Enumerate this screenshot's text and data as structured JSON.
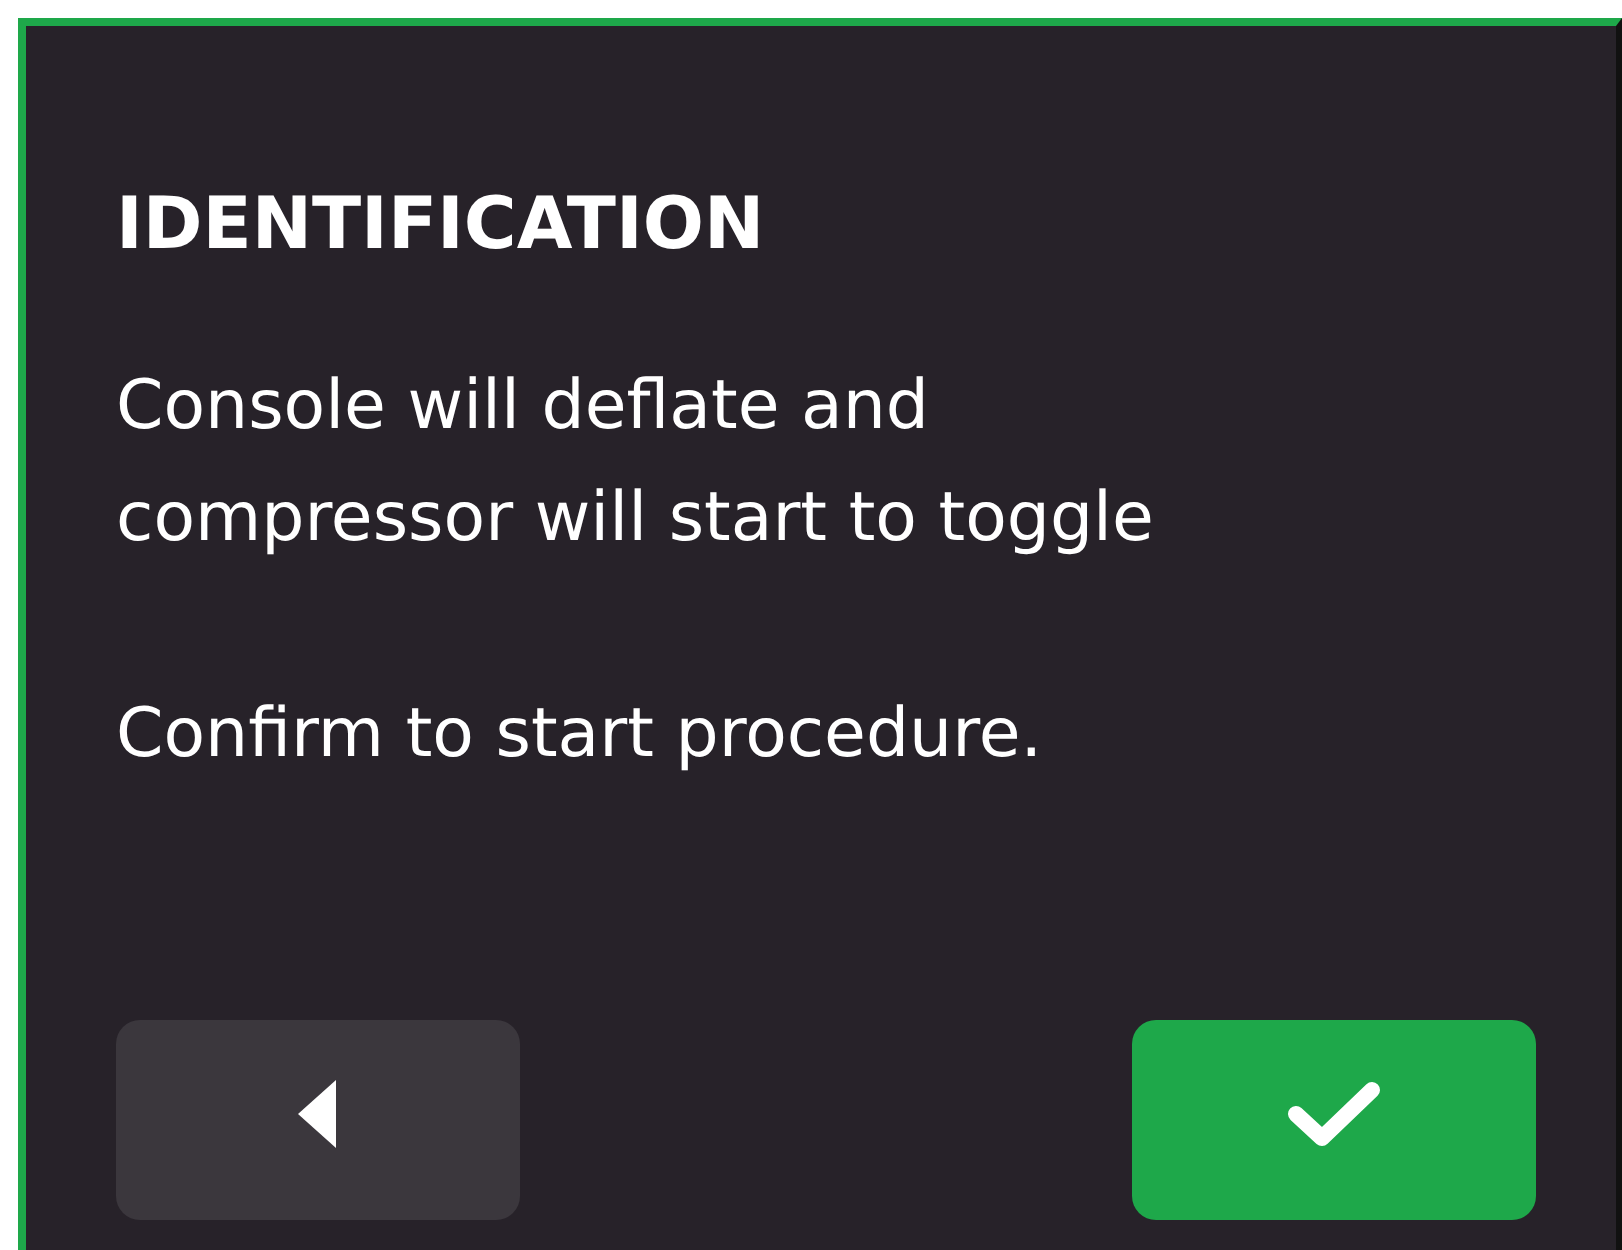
{
  "screen": {
    "title": "IDENTIFICATION",
    "message_lines": [
      "Console will deflate and",
      "compressor will start to toggle"
    ],
    "instruction": "Confirm to start procedure."
  },
  "buttons": [
    {
      "kind": "back"
    },
    {
      "kind": "confirm"
    }
  ]
}
